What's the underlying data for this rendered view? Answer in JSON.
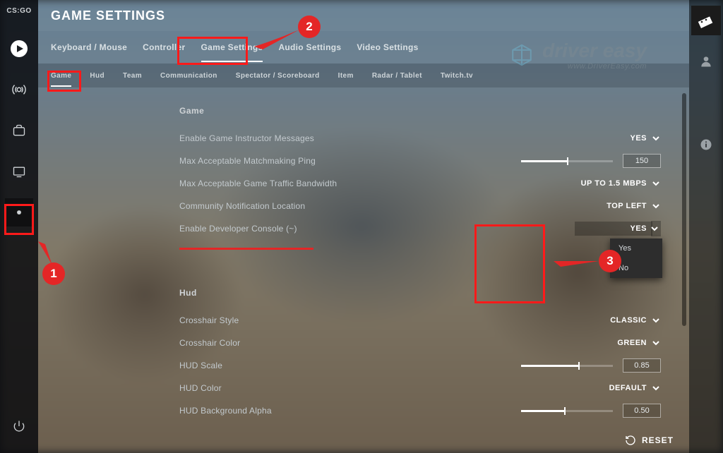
{
  "logo": "CS:GO",
  "page_title": "GAME SETTINGS",
  "primary_tabs": [
    "Keyboard / Mouse",
    "Controller",
    "Game Settings",
    "Audio Settings",
    "Video Settings"
  ],
  "primary_active_index": 2,
  "secondary_tabs": [
    "Game",
    "Hud",
    "Team",
    "Communication",
    "Spectator / Scoreboard",
    "Item",
    "Radar / Tablet",
    "Twitch.tv"
  ],
  "secondary_active_index": 0,
  "watermark": {
    "brand": "driver easy",
    "url": "www.DriverEasy.com"
  },
  "sections": {
    "game": {
      "title": "Game",
      "rows": {
        "instructor": {
          "label": "Enable Game Instructor Messages",
          "value": "YES"
        },
        "ping": {
          "label": "Max Acceptable Matchmaking Ping",
          "value": "150",
          "slider_pct": 50
        },
        "bw": {
          "label": "Max Acceptable Game Traffic Bandwidth",
          "value": "UP TO 1.5 MBPS"
        },
        "notif": {
          "label": "Community Notification Location",
          "value": "TOP LEFT"
        },
        "devcon": {
          "label": "Enable Developer Console (~)",
          "value": "YES"
        }
      },
      "devcon_options": [
        "Yes",
        "No"
      ]
    },
    "hud": {
      "title": "Hud",
      "rows": {
        "cstyle": {
          "label": "Crosshair Style",
          "value": "CLASSIC"
        },
        "ccolor": {
          "label": "Crosshair Color",
          "value": "GREEN"
        },
        "hscale": {
          "label": "HUD Scale",
          "value": "0.85",
          "slider_pct": 62
        },
        "hcolor": {
          "label": "HUD Color",
          "value": "DEFAULT"
        },
        "halpha": {
          "label": "HUD Background Alpha",
          "value": "0.50",
          "slider_pct": 47
        }
      }
    }
  },
  "callouts": {
    "c1": "1",
    "c2": "2",
    "c3": "3"
  },
  "reset_label": "RESET"
}
